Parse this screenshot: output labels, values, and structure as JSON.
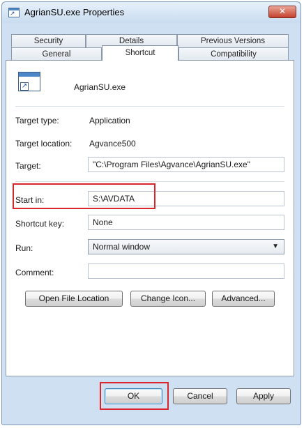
{
  "window": {
    "title": "AgrianSU.exe Properties",
    "close_glyph": "✕"
  },
  "tabs": {
    "row1": [
      {
        "label": "Security"
      },
      {
        "label": "Details"
      },
      {
        "label": "Previous Versions"
      }
    ],
    "row2": [
      {
        "label": "General"
      },
      {
        "label": "Shortcut",
        "selected": true
      },
      {
        "label": "Compatibility"
      }
    ]
  },
  "shortcut": {
    "name": "AgrianSU.exe",
    "icon": "shortcut-app-icon",
    "target_type_label": "Target type:",
    "target_type_value": "Application",
    "target_location_label": "Target location:",
    "target_location_value": "Agvance500",
    "target_label": "Target:",
    "target_value": "\"C:\\Program Files\\Agvance\\AgrianSU.exe\"",
    "start_in_label": "Start in:",
    "start_in_value": "S:\\AVDATA",
    "shortcut_key_label": "Shortcut key:",
    "shortcut_key_value": "None",
    "run_label": "Run:",
    "run_value": "Normal window",
    "comment_label": "Comment:",
    "comment_value": ""
  },
  "buttons": {
    "open_file_location": "Open File Location",
    "change_icon": "Change Icon...",
    "advanced": "Advanced...",
    "ok": "OK",
    "cancel": "Cancel",
    "apply": "Apply"
  },
  "colors": {
    "highlight": "#d9262a",
    "window_frame": "#cfe0f2"
  }
}
